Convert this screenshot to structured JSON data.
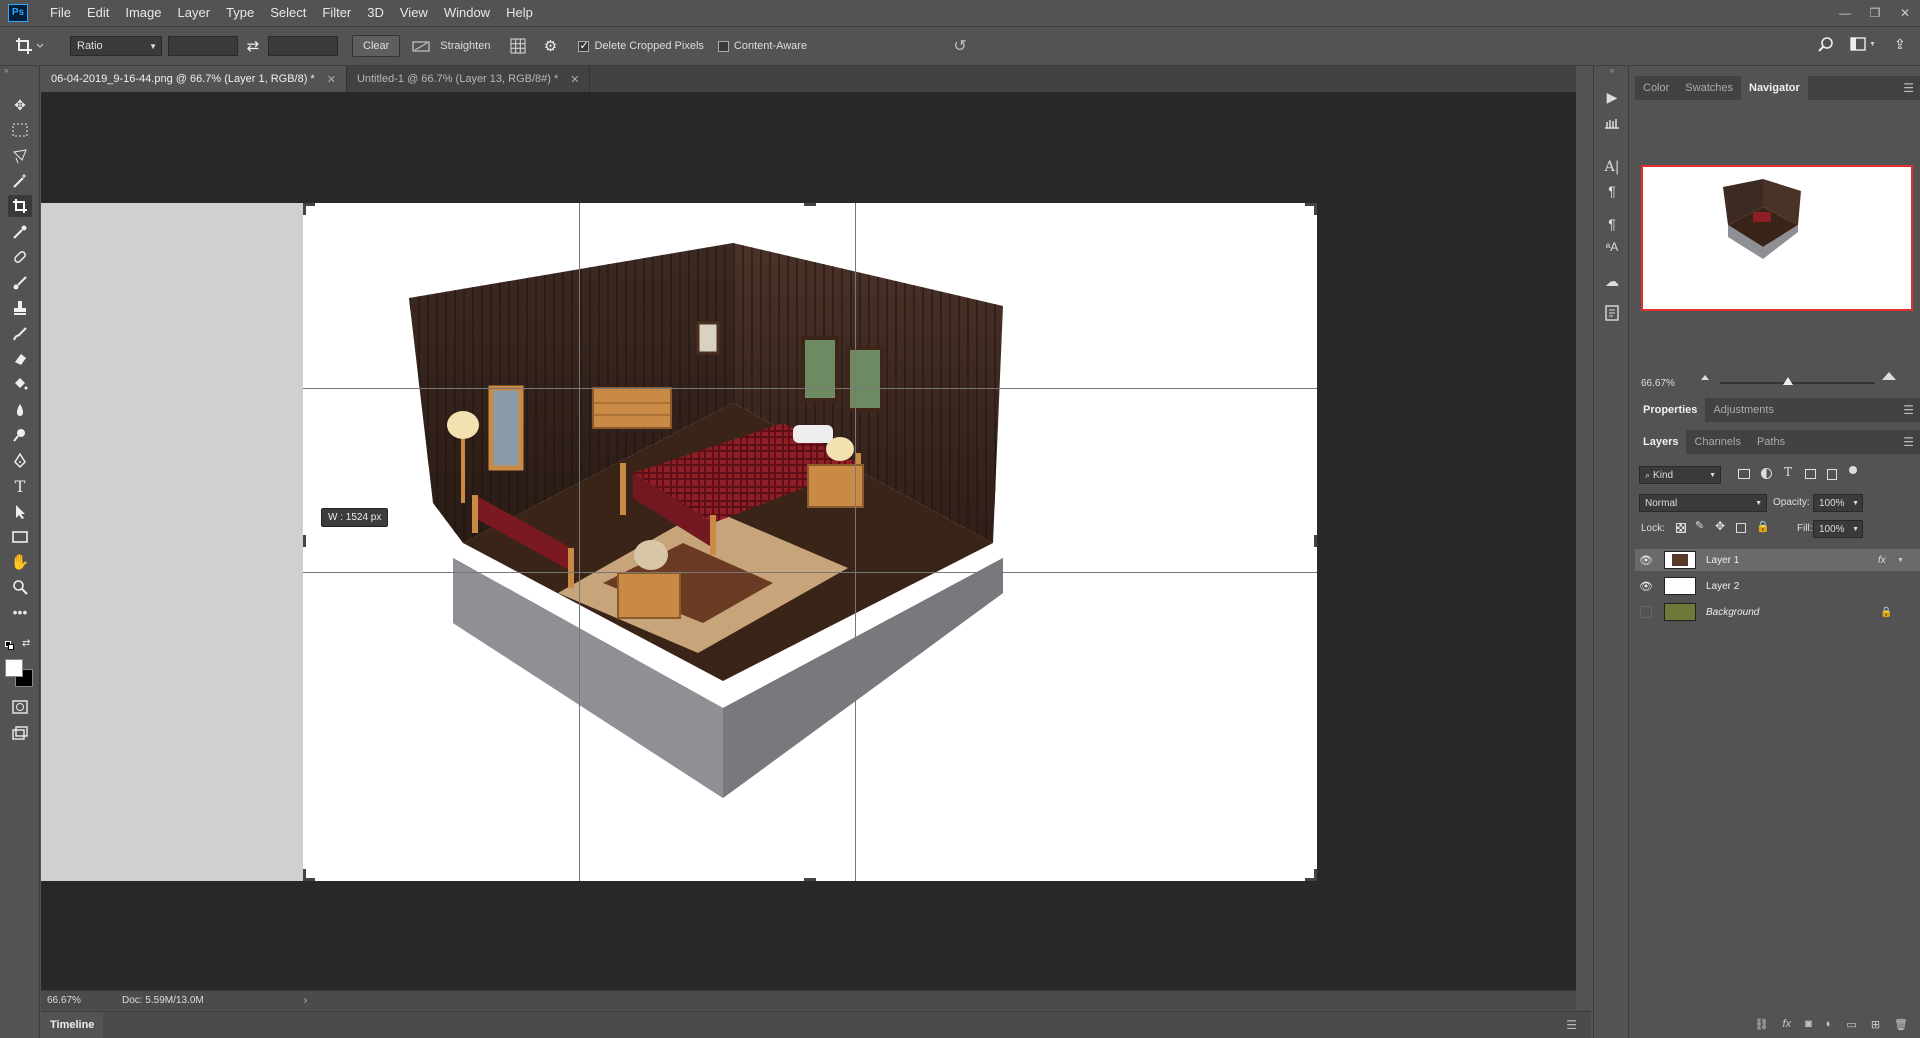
{
  "app": {
    "logo": "Ps"
  },
  "menu": [
    "File",
    "Edit",
    "Image",
    "Layer",
    "Type",
    "Select",
    "Filter",
    "3D",
    "View",
    "Window",
    "Help"
  ],
  "window_controls": {
    "minimize": "—",
    "restore": "❐",
    "close": "✕"
  },
  "options": {
    "ratio": "Ratio",
    "clear_label": "Clear",
    "straighten_label": "Straighten",
    "delete_cropped_label": "Delete Cropped Pixels",
    "delete_cropped_checked": true,
    "content_aware_label": "Content-Aware",
    "content_aware_checked": false
  },
  "tabs": [
    {
      "label": "06-04-2019_9-16-44.png @ 66.7% (Layer 1, RGB/8) *",
      "active": true
    },
    {
      "label": "Untitled-1 @ 66.7% (Layer 13, RGB/8#) *",
      "active": false
    }
  ],
  "canvas": {
    "size_tip": "W : 1524 px"
  },
  "status": {
    "zoom": "66.67%",
    "doc": "Doc: 5.59M/13.0M"
  },
  "timeline": {
    "label": "Timeline"
  },
  "panel_tabs_top": [
    "Color",
    "Swatches",
    "Navigator"
  ],
  "navigator": {
    "zoom": "66.67%"
  },
  "panel_tabs_mid": [
    "Properties",
    "Adjustments"
  ],
  "panel_tabs_layers": [
    "Layers",
    "Channels",
    "Paths"
  ],
  "layers_panel": {
    "kind": "Kind",
    "blend_mode": "Normal",
    "opacity_label": "Opacity:",
    "opacity": "100%",
    "lock_label": "Lock:",
    "fill_label": "Fill:",
    "fill": "100%",
    "fx": "fx"
  },
  "layers": [
    {
      "name": "Layer 1",
      "visible": true,
      "selected": true
    },
    {
      "name": "Layer 2",
      "visible": true,
      "selected": false
    },
    {
      "name": "Background",
      "visible": false,
      "selected": false,
      "locked": true
    }
  ]
}
